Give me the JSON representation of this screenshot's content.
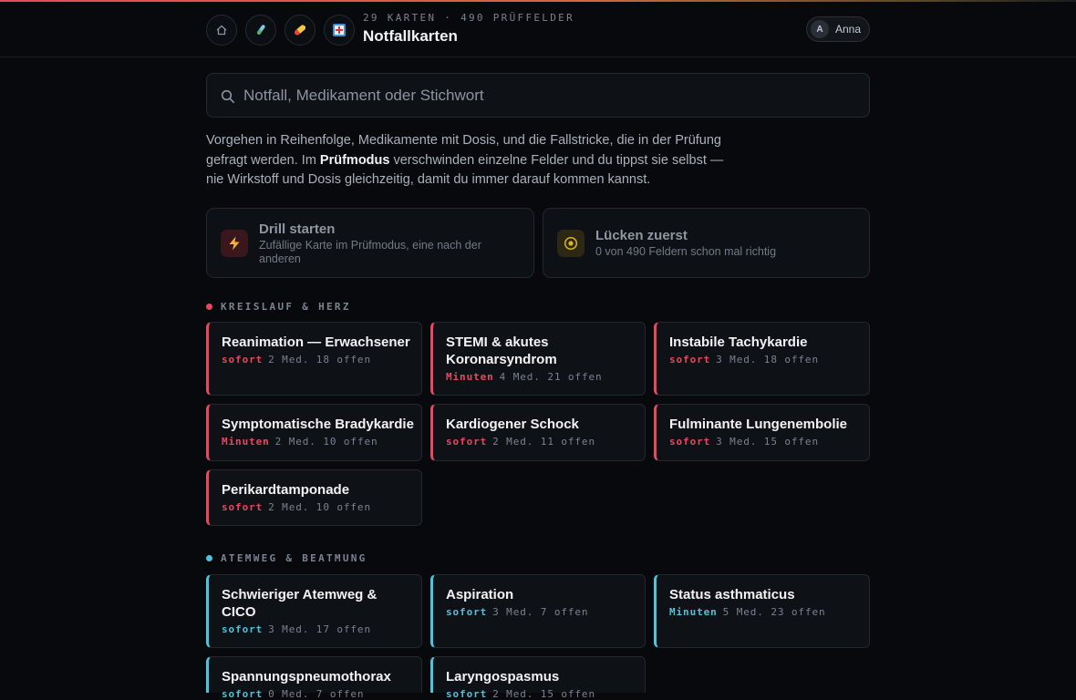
{
  "header": {
    "nav_icons": [
      "home-icon",
      "test-tube-icon",
      "pill-icon",
      "hospital-icon"
    ],
    "meta": "29 KARTEN · 490 PRÜFFELDER",
    "title": "Notfallkarten",
    "user": {
      "initial": "A",
      "name": "Anna"
    }
  },
  "search": {
    "placeholder": "Notfall, Medikament oder Stichwort",
    "value": ""
  },
  "intro": {
    "part1": "Vorgehen in Reihenfolge, Medikamente mit Dosis, und die Fallstricke, die in der Prüfung gefragt werden. Im ",
    "bold": "Prüfmodus",
    "part2": " verschwinden einzelne Felder und du tippst sie selbst — nie Wirkstoff und Dosis gleichzeitig, damit du immer darauf kommen kannst."
  },
  "actions": [
    {
      "title": "Drill starten",
      "subtitle": "Zufällige Karte im Prüfmodus, eine nach der anderen",
      "icon": "lightning-icon",
      "accent": "#e9485f"
    },
    {
      "title": "Lücken zuerst",
      "subtitle": "0 von 490 Feldern schon mal richtig",
      "icon": "target-icon",
      "accent": "#d6b52a"
    }
  ],
  "sections": [
    {
      "label": "KREISLAUF & HERZ",
      "color": "#e9485f",
      "cards": [
        {
          "title": "Reanimation — Erwachsener",
          "urgency": "sofort",
          "meta": "2 Med. 18 offen"
        },
        {
          "title": "STEMI & akutes Koronarsyndrom",
          "urgency": "Minuten",
          "meta": "4 Med. 21 offen"
        },
        {
          "title": "Instabile Tachykardie",
          "urgency": "sofort",
          "meta": "3 Med. 18 offen"
        },
        {
          "title": "Symptomatische Bradykardie",
          "urgency": "Minuten",
          "meta": "2 Med. 10 offen"
        },
        {
          "title": "Kardiogener Schock",
          "urgency": "sofort",
          "meta": "2 Med. 11 offen"
        },
        {
          "title": "Fulminante Lungenembolie",
          "urgency": "sofort",
          "meta": "3 Med. 15 offen"
        },
        {
          "title": "Perikardtamponade",
          "urgency": "sofort",
          "meta": "2 Med. 10 offen"
        }
      ]
    },
    {
      "label": "ATEMWEG & BEATMUNG",
      "color": "#4cc4da",
      "cards": [
        {
          "title": "Schwieriger Atemweg & CICO",
          "urgency": "sofort",
          "meta": "3 Med. 17 offen"
        },
        {
          "title": "Aspiration",
          "urgency": "sofort",
          "meta": "3 Med. 7 offen"
        },
        {
          "title": "Status asthmaticus",
          "urgency": "Minuten",
          "meta": "5 Med. 23 offen"
        },
        {
          "title": "Spannungspneumothorax",
          "urgency": "sofort",
          "meta": "0 Med. 7 offen"
        },
        {
          "title": "Laryngospasmus",
          "urgency": "sofort",
          "meta": "2 Med. 15 offen"
        }
      ]
    }
  ]
}
